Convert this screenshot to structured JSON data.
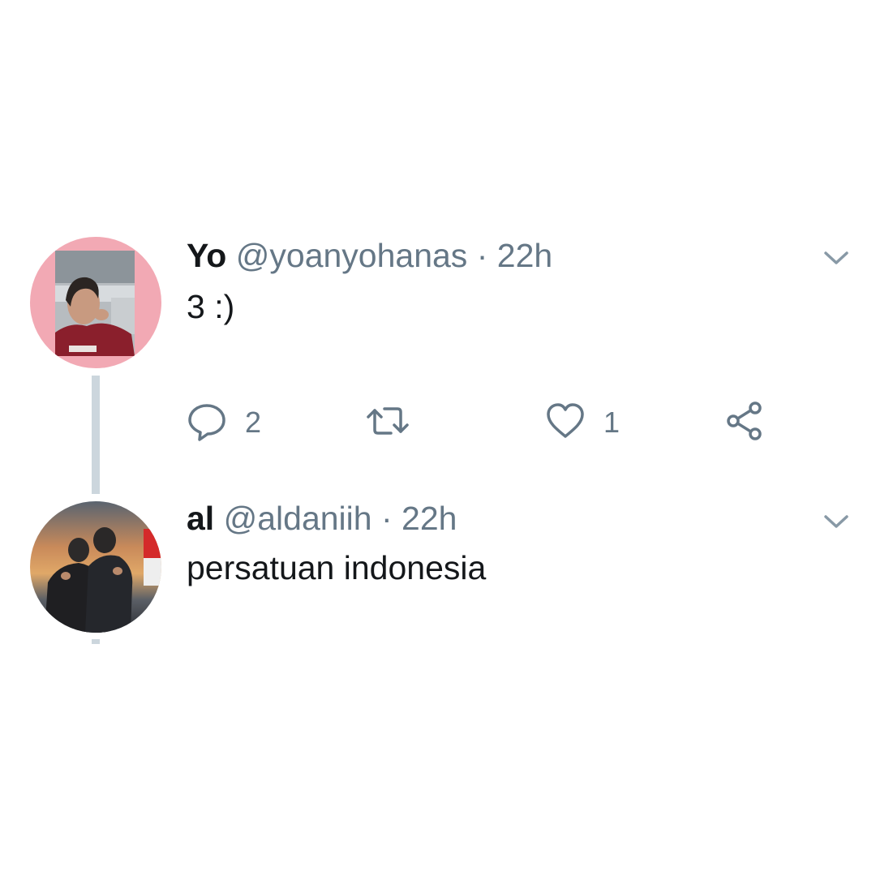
{
  "tweets": [
    {
      "display_name": "Yo",
      "handle": "@yoanyohanas",
      "separator": "·",
      "time": "22h",
      "text": "3 :)",
      "avatar_icon": "avatar-photo",
      "actions": {
        "reply_count": "2",
        "retweet_count": "",
        "like_count": "1"
      }
    },
    {
      "display_name": "al",
      "handle": "@aldaniih",
      "separator": "·",
      "time": "22h",
      "text": "persatuan indonesia",
      "avatar_icon": "avatar-photo"
    }
  ],
  "colors": {
    "text_primary": "#14171a",
    "text_secondary": "#657786",
    "thread_line": "#ccd6dd",
    "avatar_ring": "#f2a9b4",
    "icon": "#657786"
  },
  "icons": [
    "reply-icon",
    "retweet-icon",
    "like-icon",
    "share-icon",
    "chevron-down-icon"
  ]
}
